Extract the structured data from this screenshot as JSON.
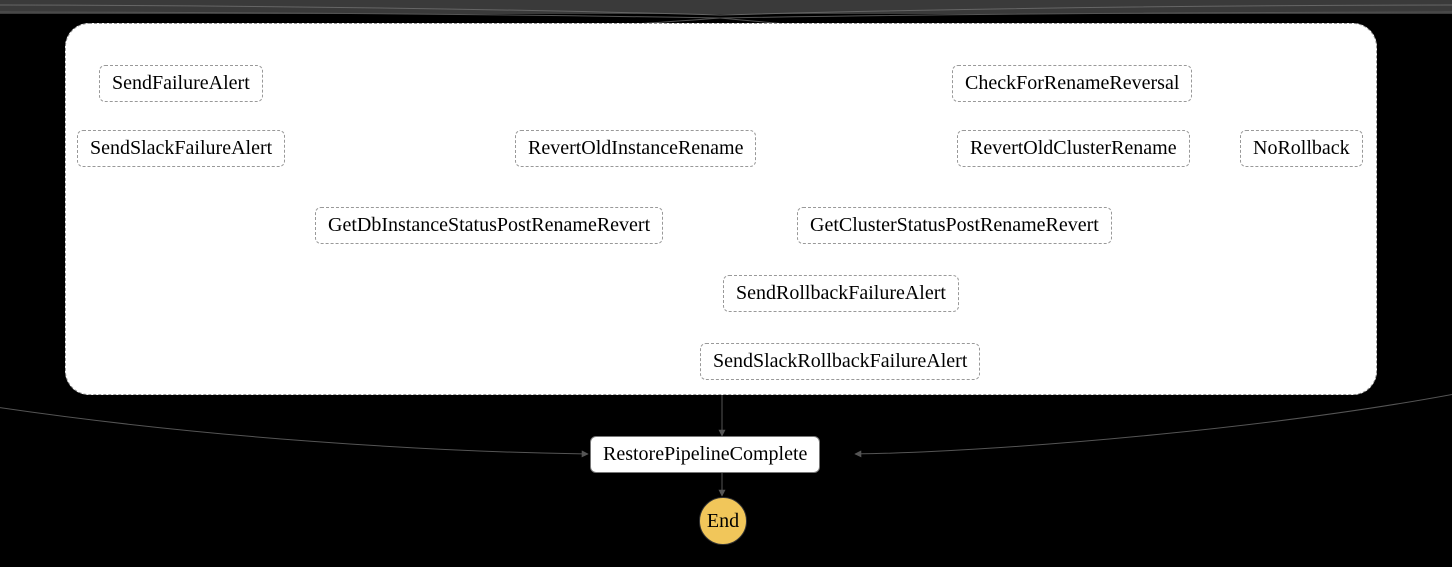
{
  "chart_data": {
    "type": "flowchart",
    "title": "",
    "group": {
      "id": "failure-rollback-group",
      "children": [
        "SendFailureAlert",
        "SendSlackFailureAlert",
        "CheckForRenameReversal",
        "RevertOldInstanceRename",
        "RevertOldClusterRename",
        "NoRollback",
        "GetDbInstanceStatusPostRenameRevert",
        "GetClusterStatusPostRenameRevert",
        "SendRollbackFailureAlert",
        "SendSlackRollbackFailureAlert"
      ]
    },
    "nodes": [
      {
        "id": "SendFailureAlert",
        "label": "SendFailureAlert",
        "style": "dashed"
      },
      {
        "id": "SendSlackFailureAlert",
        "label": "SendSlackFailureAlert",
        "style": "dashed"
      },
      {
        "id": "CheckForRenameReversal",
        "label": "CheckForRenameReversal",
        "style": "dashed"
      },
      {
        "id": "RevertOldInstanceRename",
        "label": "RevertOldInstanceRename",
        "style": "dashed"
      },
      {
        "id": "RevertOldClusterRename",
        "label": "RevertOldClusterRename",
        "style": "dashed"
      },
      {
        "id": "NoRollback",
        "label": "NoRollback",
        "style": "dashed"
      },
      {
        "id": "GetDbInstanceStatusPostRenameRevert",
        "label": "GetDbInstanceStatusPostRenameRevert",
        "style": "dashed"
      },
      {
        "id": "GetClusterStatusPostRenameRevert",
        "label": "GetClusterStatusPostRenameRevert",
        "style": "dashed"
      },
      {
        "id": "SendRollbackFailureAlert",
        "label": "SendRollbackFailureAlert",
        "style": "dashed"
      },
      {
        "id": "SendSlackRollbackFailureAlert",
        "label": "SendSlackRollbackFailureAlert",
        "style": "dashed"
      },
      {
        "id": "RestorePipelineComplete",
        "label": "RestorePipelineComplete",
        "style": "solid"
      },
      {
        "id": "End",
        "label": "End",
        "style": "terminal"
      }
    ],
    "edges": [
      {
        "from": "TOP_ENTRY",
        "to": "SendFailureAlert"
      },
      {
        "from": "TOP_ENTRY",
        "to": "CheckForRenameReversal"
      },
      {
        "from": "SendFailureAlert",
        "to": "SendSlackFailureAlert"
      },
      {
        "from": "CheckForRenameReversal",
        "to": "RevertOldInstanceRename"
      },
      {
        "from": "CheckForRenameReversal",
        "to": "RevertOldClusterRename"
      },
      {
        "from": "CheckForRenameReversal",
        "to": "NoRollback"
      },
      {
        "from": "RevertOldInstanceRename",
        "to": "GetDbInstanceStatusPostRenameRevert"
      },
      {
        "from": "RevertOldInstanceRename",
        "to": "SendRollbackFailureAlert"
      },
      {
        "from": "RevertOldClusterRename",
        "to": "GetClusterStatusPostRenameRevert"
      },
      {
        "from": "RevertOldClusterRename",
        "to": "SendRollbackFailureAlert"
      },
      {
        "from": "GetDbInstanceStatusPostRenameRevert",
        "to": "SendRollbackFailureAlert"
      },
      {
        "from": "GetClusterStatusPostRenameRevert",
        "to": "SendRollbackFailureAlert"
      },
      {
        "from": "SendRollbackFailureAlert",
        "to": "SendSlackRollbackFailureAlert"
      },
      {
        "from": "GROUP_BOTTOM",
        "to": "RestorePipelineComplete"
      },
      {
        "from": "EXTERNAL_RIGHT",
        "to": "RestorePipelineComplete"
      },
      {
        "from": "EXTERNAL_LEFT",
        "to": "RestorePipelineComplete"
      },
      {
        "from": "RestorePipelineComplete",
        "to": "End"
      }
    ]
  }
}
